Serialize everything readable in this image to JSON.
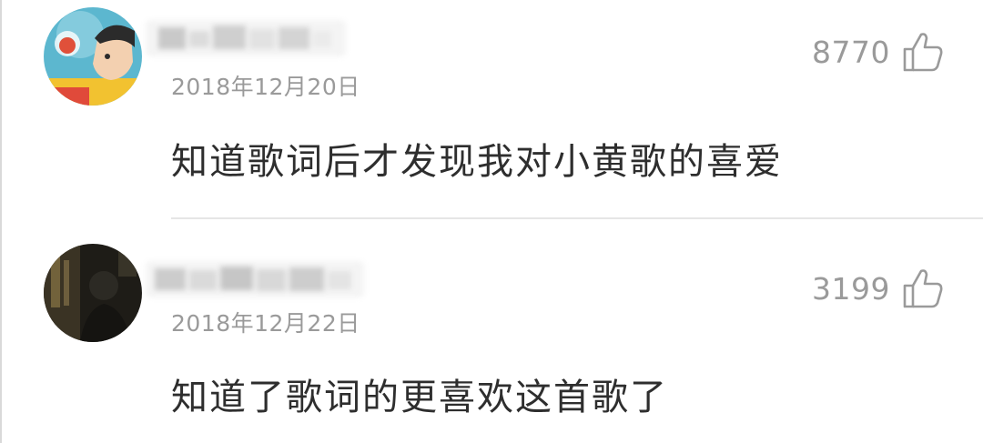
{
  "comments": [
    {
      "date": "2018年12月20日",
      "likes": "8770",
      "text": "知道歌词后才发现我对小黄歌的喜爱",
      "avatar_icon": "cartoon-avatar-icon",
      "like_icon": "thumbs-up-icon"
    },
    {
      "date": "2018年12月22日",
      "likes": "3199",
      "text": "知道了歌词的更喜欢这首歌了",
      "avatar_icon": "photo-avatar-icon",
      "like_icon": "thumbs-up-icon"
    }
  ],
  "colors": {
    "meta_text": "#9a9a9a",
    "body_text": "#2e2e2e",
    "divider": "#e6e6e6"
  }
}
